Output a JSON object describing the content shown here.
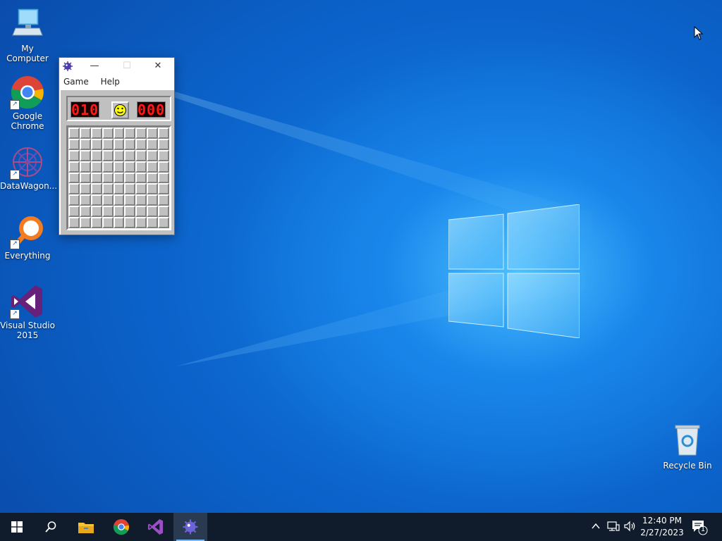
{
  "desktop": {
    "icons": [
      {
        "label": "My Computer"
      },
      {
        "label": "Google Chrome"
      },
      {
        "label": "DataWagon..."
      },
      {
        "label": "Everything"
      },
      {
        "label": "Visual Studio 2015"
      },
      {
        "label": "Recycle Bin"
      }
    ]
  },
  "minesweeper": {
    "menu": {
      "game": "Game",
      "help": "Help"
    },
    "mine_counter": "010",
    "timer": "000",
    "grid": {
      "rows": 9,
      "cols": 9
    }
  },
  "taskbar": {
    "clock": {
      "time": "12:40 PM",
      "date": "2/27/2023"
    },
    "notification_count": "1"
  },
  "colors": {
    "led_red": "#ff1a1a",
    "taskbar": "#101c2c",
    "desktop_blue": "#0b62c9"
  }
}
